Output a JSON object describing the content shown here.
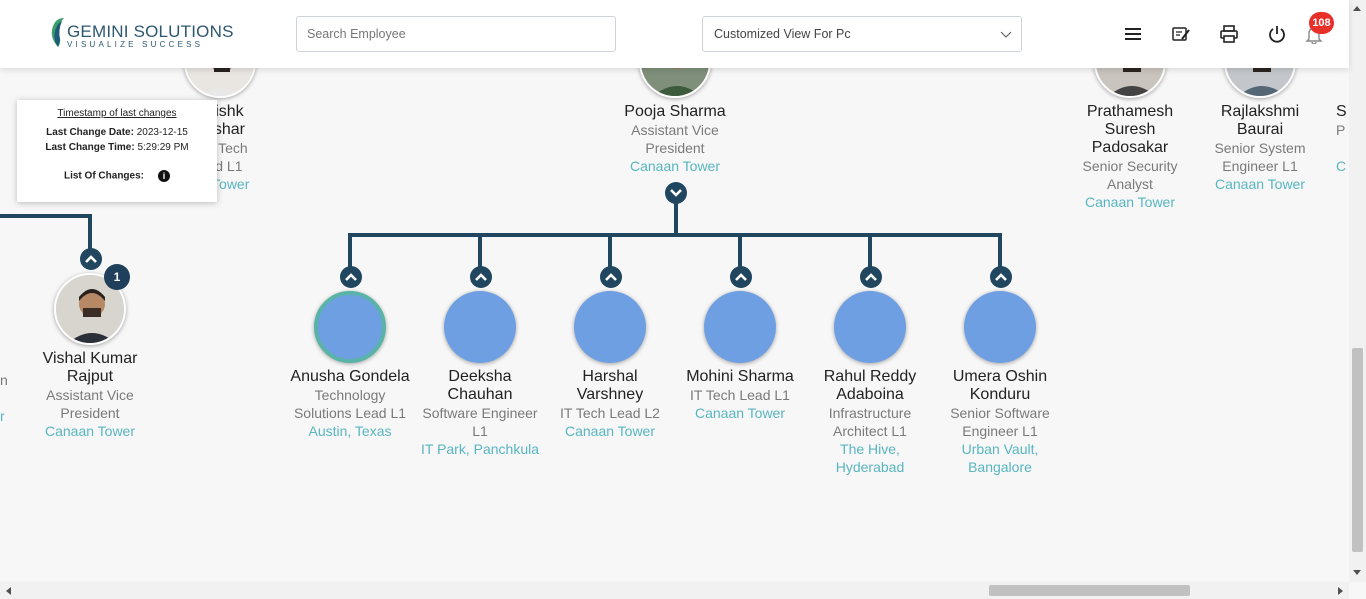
{
  "header": {
    "logo_name": "GEMINI SOLUTIONS",
    "logo_tagline": "VISUALIZE SUCCESS",
    "search_placeholder": "Search Employee",
    "view_selected": "Customized View For Pc",
    "notification_count": "108",
    "icons": [
      "menu-icon",
      "edit-note-icon",
      "print-icon",
      "power-icon",
      "bell-icon"
    ]
  },
  "timestamp_card": {
    "title": "Timestamp of last changes",
    "date_label": "Last Change Date:",
    "date_value": "2023-12-15",
    "time_label": "Last Change Time:",
    "time_value": "5:29:29 PM",
    "changes_label": "List Of Changes:"
  },
  "top_row": [
    {
      "name_lines": [
        "nishk",
        "ashar"
      ],
      "role_lines": [
        "IT Tech",
        "ad L1"
      ],
      "location_lines": [
        "n Tower"
      ]
    },
    {
      "name_lines": [
        "Pooja Sharma"
      ],
      "role_lines": [
        "Assistant Vice",
        "President"
      ],
      "location_lines": [
        "Canaan Tower"
      ]
    },
    {
      "name_lines": [
        "Prathamesh",
        "Suresh",
        "Padosakar"
      ],
      "role_lines": [
        "Senior Security",
        "Analyst"
      ],
      "location_lines": [
        "Canaan Tower"
      ]
    },
    {
      "name_lines": [
        "Rajlakshmi",
        "Baurai"
      ],
      "role_lines": [
        "Senior System",
        "Engineer L1"
      ],
      "location_lines": [
        "Canaan Tower"
      ]
    },
    {
      "name_lines": [
        "S"
      ],
      "role_lines": [
        "P"
      ],
      "location_lines": [
        "C"
      ]
    }
  ],
  "left_partial": {
    "role_fragment": "n",
    "location_fragment": "r"
  },
  "vishal": {
    "name_lines": [
      "Vishal Kumar",
      "Rajput"
    ],
    "role_lines": [
      "Assistant Vice",
      "President"
    ],
    "location_lines": [
      "Canaan Tower"
    ],
    "reports_count": "1"
  },
  "children": [
    {
      "name_lines": [
        "Anusha Gondela"
      ],
      "role_lines": [
        "Technology",
        "Solutions Lead L1"
      ],
      "location_lines": [
        "Austin, Texas"
      ]
    },
    {
      "name_lines": [
        "Deeksha",
        "Chauhan"
      ],
      "role_lines": [
        "Software Engineer",
        "L1"
      ],
      "location_lines": [
        "IT Park, Panchkula"
      ]
    },
    {
      "name_lines": [
        "Harshal",
        "Varshney"
      ],
      "role_lines": [
        "IT Tech Lead L2"
      ],
      "location_lines": [
        "Canaan Tower"
      ]
    },
    {
      "name_lines": [
        "Mohini Sharma"
      ],
      "role_lines": [
        "IT Tech Lead L1"
      ],
      "location_lines": [
        "Canaan Tower"
      ]
    },
    {
      "name_lines": [
        "Rahul Reddy",
        "Adaboina"
      ],
      "role_lines": [
        "Infrastructure",
        "Architect L1"
      ],
      "location_lines": [
        "The Hive,",
        "Hyderabad"
      ]
    },
    {
      "name_lines": [
        "Umera Oshin",
        "Konduru"
      ],
      "role_lines": [
        "Senior Software",
        "Engineer L1"
      ],
      "location_lines": [
        "Urban Vault,",
        "Bangalore"
      ]
    }
  ],
  "colors": {
    "connector": "#20475f",
    "location": "#58b6c0",
    "avatar_placeholder": "#6e9fe3",
    "badge": "#e8302b"
  }
}
